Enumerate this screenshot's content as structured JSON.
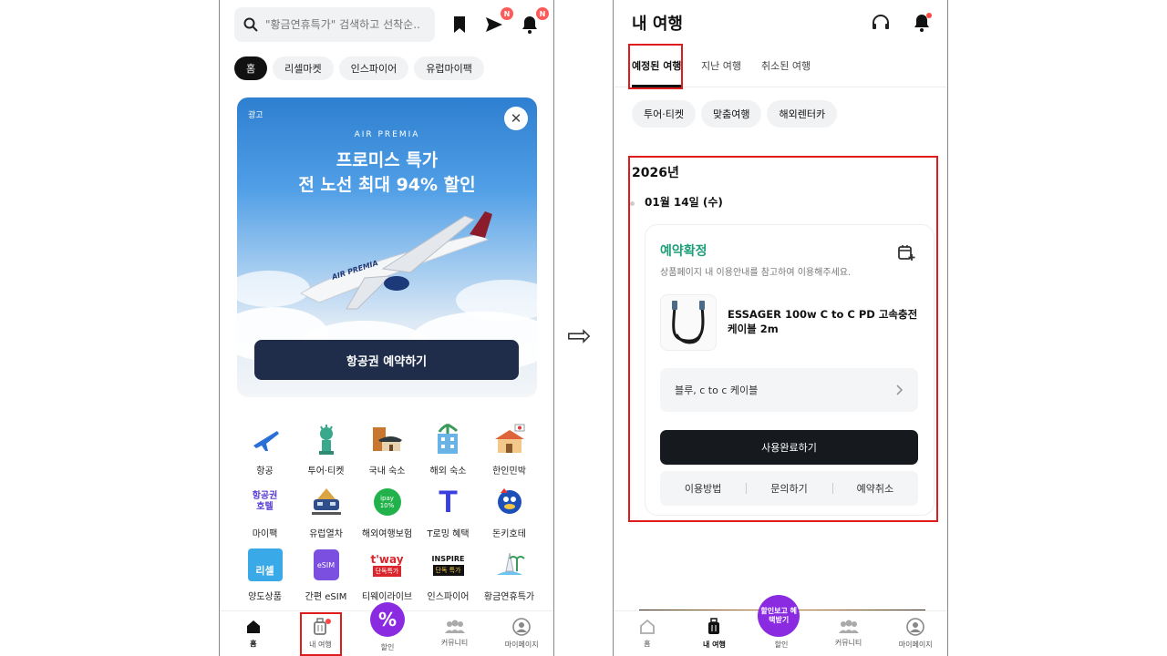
{
  "left": {
    "search_placeholder": "\"황금연휴특가\" 검색하고 선착순...",
    "badges": [
      "N",
      "N"
    ],
    "chips": [
      "홈",
      "리셀마켓",
      "인스파이어",
      "유럽마이팩"
    ],
    "ad": {
      "label": "광고",
      "brand": "AIR PREMIA",
      "title_line1": "프로미스 특가",
      "title_line2": "전 노선 최대 94% 할인",
      "cta": "항공권 예약하기",
      "close": "✕",
      "plane_text": "AIR PREMIA"
    },
    "grid": [
      {
        "label": "항공",
        "icon": "airplane-icon"
      },
      {
        "label": "투어·티켓",
        "icon": "statue-of-liberty-icon"
      },
      {
        "label": "국내 숙소",
        "icon": "hanok-icon"
      },
      {
        "label": "해외 숙소",
        "icon": "building-palm-icon"
      },
      {
        "label": "한인민박",
        "icon": "korean-house-icon"
      },
      {
        "label": "마이팩",
        "icon": "flight-hotel-icon",
        "text": "항공권 호텔"
      },
      {
        "label": "유럽열차",
        "icon": "train-icon"
      },
      {
        "label": "해외여행보험",
        "icon": "insurance-icon",
        "text": "ipay 10%"
      },
      {
        "label": "T로밍 혜택",
        "icon": "t-roaming-icon",
        "text": "T"
      },
      {
        "label": "돈키호테",
        "icon": "donki-icon"
      },
      {
        "label": "양도상품",
        "icon": "resell-icon",
        "text": "리셀"
      },
      {
        "label": "간편 eSIM",
        "icon": "esim-icon",
        "text": "eSIM"
      },
      {
        "label": "티웨이라이브",
        "icon": "tway-icon",
        "text": "t'way",
        "sub": "단독특가"
      },
      {
        "label": "인스파이어",
        "icon": "inspire-icon",
        "text": "INSPIRE",
        "sub": "단독 특가"
      },
      {
        "label": "황금연휴특가",
        "icon": "golden-holiday-icon"
      }
    ],
    "tabbar": [
      {
        "label": "홈",
        "icon": "home-icon"
      },
      {
        "label": "내 여행",
        "icon": "luggage-icon"
      },
      {
        "label": "할인",
        "icon": "discount-icon"
      },
      {
        "label": "커뮤니티",
        "icon": "community-icon"
      },
      {
        "label": "마이페이지",
        "icon": "profile-icon"
      }
    ]
  },
  "arrow": "⇨",
  "right": {
    "title": "내 여행",
    "tabs": [
      "예정된 여행",
      "지난 여행",
      "취소된 여행"
    ],
    "chips": [
      "투어·티켓",
      "맞춤여행",
      "해외렌터카"
    ],
    "year": "2026년",
    "date": "01월 14일 (수)",
    "booking": {
      "status": "예약확정",
      "status_desc": "상품페이지 내 이용안내를 참고하여 이용해주세요.",
      "product_name": "ESSAGER 100w C to C PD 고속충전케이블 2m",
      "option": "블루, c to c 케이블",
      "primary_action": "사용완료하기",
      "actions": [
        "이용방법",
        "문의하기",
        "예약취소"
      ]
    },
    "promo_bubble": "할인보고 혜택받기",
    "tabbar": [
      {
        "label": "홈",
        "icon": "home-icon"
      },
      {
        "label": "내 여행",
        "icon": "luggage-icon"
      },
      {
        "label": "할인",
        "icon": "discount-icon"
      },
      {
        "label": "커뮤니티",
        "icon": "community-icon"
      },
      {
        "label": "마이페이지",
        "icon": "profile-icon"
      }
    ]
  },
  "colors": {
    "accent_green": "#1e9e78",
    "highlight_red": "#e01b1b",
    "dark_button": "#161a1f",
    "ad_cta": "#1f2d4b",
    "promo_purple": "#8a2be2"
  }
}
